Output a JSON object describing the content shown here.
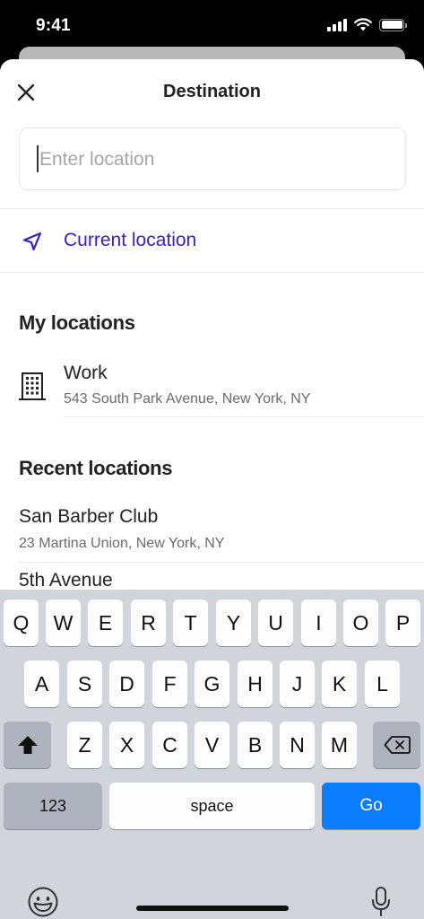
{
  "status_bar": {
    "time": "9:41"
  },
  "header": {
    "title": "Destination"
  },
  "search": {
    "placeholder": "Enter location",
    "value": ""
  },
  "current_location": {
    "label": "Current location"
  },
  "my_locations": {
    "title": "My locations",
    "items": [
      {
        "name": "Work",
        "address": "543 South Park Avenue, New York, NY"
      }
    ]
  },
  "recent_locations": {
    "title": "Recent locations",
    "items": [
      {
        "name": "San Barber Club",
        "address": "23 Martina Union, New York, NY"
      },
      {
        "name": "5th Avenue",
        "address": ""
      }
    ]
  },
  "keyboard": {
    "row1": [
      "Q",
      "W",
      "E",
      "R",
      "T",
      "Y",
      "U",
      "I",
      "O",
      "P"
    ],
    "row2": [
      "A",
      "S",
      "D",
      "F",
      "G",
      "H",
      "J",
      "K",
      "L"
    ],
    "row3": [
      "Z",
      "X",
      "C",
      "V",
      "B",
      "N",
      "M"
    ],
    "numbers_label": "123",
    "space_label": "space",
    "go_label": "Go"
  },
  "colors": {
    "accent": "#3d1cc4",
    "go_button": "#0a7cff",
    "keyboard_bg": "#d1d4db"
  },
  "icons": {
    "close": "close-icon",
    "navigation": "navigation-arrow-icon",
    "building": "building-icon",
    "shift": "shift-icon",
    "backspace": "backspace-icon",
    "emoji": "emoji-icon",
    "microphone": "microphone-icon"
  }
}
